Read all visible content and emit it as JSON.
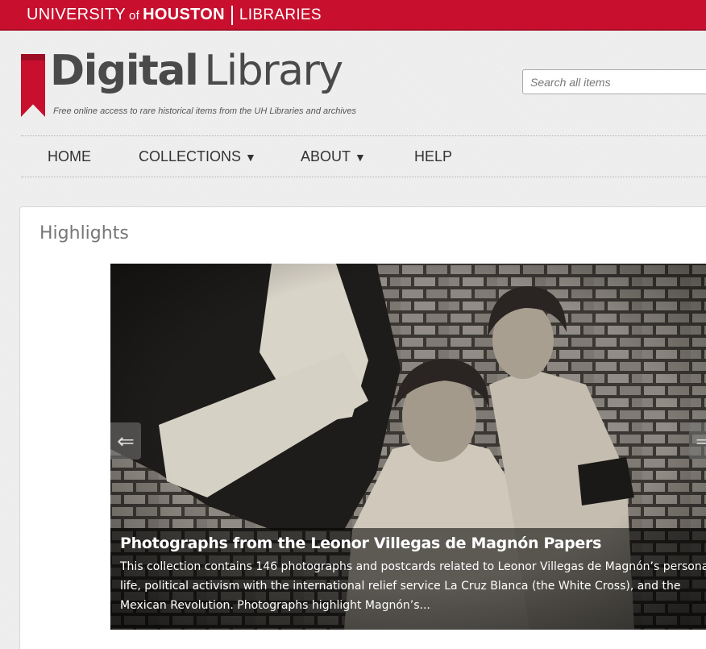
{
  "header": {
    "university": "UNIVERSITY",
    "of": "of",
    "houston": "HOUSTON",
    "libraries": "LIBRARIES",
    "brand_color": "#c8102e"
  },
  "brand": {
    "title_bold": "Digital",
    "title_light": "Library",
    "tagline": "Free online access to rare historical items from the UH Libraries and archives",
    "ribbon_icon": "bookmark-ribbon"
  },
  "search": {
    "placeholder": "Search all items",
    "value": ""
  },
  "nav": {
    "items": [
      {
        "label": "HOME"
      },
      {
        "label": "COLLECTIONS",
        "caret": "▼"
      },
      {
        "label": "ABOUT",
        "caret": "▼"
      },
      {
        "label": "HELP"
      }
    ]
  },
  "highlights": {
    "heading": "Highlights",
    "slide": {
      "title": "Photographs from the Leonor Villegas de Magnón Papers",
      "description": "This collection contains 146 photographs and postcards related to Leonor Villegas de Magnón’s personal life, political activism with the international relief service La Cruz Blanca (the White Cross), and the Mexican Revolution. Photographs highlight Magnón’s...",
      "prev_icon": "arrow-left-icon",
      "next_icon": "arrow-right-icon",
      "prev_glyph": "⇐",
      "next_glyph": "⇒"
    }
  }
}
